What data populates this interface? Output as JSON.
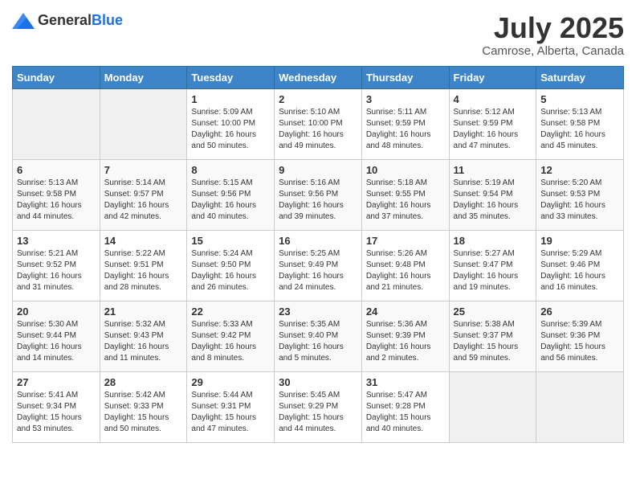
{
  "header": {
    "logo_general": "General",
    "logo_blue": "Blue",
    "month": "July 2025",
    "location": "Camrose, Alberta, Canada"
  },
  "weekdays": [
    "Sunday",
    "Monday",
    "Tuesday",
    "Wednesday",
    "Thursday",
    "Friday",
    "Saturday"
  ],
  "weeks": [
    [
      {
        "day": "",
        "sunrise": "",
        "sunset": "",
        "daylight": ""
      },
      {
        "day": "",
        "sunrise": "",
        "sunset": "",
        "daylight": ""
      },
      {
        "day": "1",
        "sunrise": "Sunrise: 5:09 AM",
        "sunset": "Sunset: 10:00 PM",
        "daylight": "Daylight: 16 hours and 50 minutes."
      },
      {
        "day": "2",
        "sunrise": "Sunrise: 5:10 AM",
        "sunset": "Sunset: 10:00 PM",
        "daylight": "Daylight: 16 hours and 49 minutes."
      },
      {
        "day": "3",
        "sunrise": "Sunrise: 5:11 AM",
        "sunset": "Sunset: 9:59 PM",
        "daylight": "Daylight: 16 hours and 48 minutes."
      },
      {
        "day": "4",
        "sunrise": "Sunrise: 5:12 AM",
        "sunset": "Sunset: 9:59 PM",
        "daylight": "Daylight: 16 hours and 47 minutes."
      },
      {
        "day": "5",
        "sunrise": "Sunrise: 5:13 AM",
        "sunset": "Sunset: 9:58 PM",
        "daylight": "Daylight: 16 hours and 45 minutes."
      }
    ],
    [
      {
        "day": "6",
        "sunrise": "Sunrise: 5:13 AM",
        "sunset": "Sunset: 9:58 PM",
        "daylight": "Daylight: 16 hours and 44 minutes."
      },
      {
        "day": "7",
        "sunrise": "Sunrise: 5:14 AM",
        "sunset": "Sunset: 9:57 PM",
        "daylight": "Daylight: 16 hours and 42 minutes."
      },
      {
        "day": "8",
        "sunrise": "Sunrise: 5:15 AM",
        "sunset": "Sunset: 9:56 PM",
        "daylight": "Daylight: 16 hours and 40 minutes."
      },
      {
        "day": "9",
        "sunrise": "Sunrise: 5:16 AM",
        "sunset": "Sunset: 9:56 PM",
        "daylight": "Daylight: 16 hours and 39 minutes."
      },
      {
        "day": "10",
        "sunrise": "Sunrise: 5:18 AM",
        "sunset": "Sunset: 9:55 PM",
        "daylight": "Daylight: 16 hours and 37 minutes."
      },
      {
        "day": "11",
        "sunrise": "Sunrise: 5:19 AM",
        "sunset": "Sunset: 9:54 PM",
        "daylight": "Daylight: 16 hours and 35 minutes."
      },
      {
        "day": "12",
        "sunrise": "Sunrise: 5:20 AM",
        "sunset": "Sunset: 9:53 PM",
        "daylight": "Daylight: 16 hours and 33 minutes."
      }
    ],
    [
      {
        "day": "13",
        "sunrise": "Sunrise: 5:21 AM",
        "sunset": "Sunset: 9:52 PM",
        "daylight": "Daylight: 16 hours and 31 minutes."
      },
      {
        "day": "14",
        "sunrise": "Sunrise: 5:22 AM",
        "sunset": "Sunset: 9:51 PM",
        "daylight": "Daylight: 16 hours and 28 minutes."
      },
      {
        "day": "15",
        "sunrise": "Sunrise: 5:24 AM",
        "sunset": "Sunset: 9:50 PM",
        "daylight": "Daylight: 16 hours and 26 minutes."
      },
      {
        "day": "16",
        "sunrise": "Sunrise: 5:25 AM",
        "sunset": "Sunset: 9:49 PM",
        "daylight": "Daylight: 16 hours and 24 minutes."
      },
      {
        "day": "17",
        "sunrise": "Sunrise: 5:26 AM",
        "sunset": "Sunset: 9:48 PM",
        "daylight": "Daylight: 16 hours and 21 minutes."
      },
      {
        "day": "18",
        "sunrise": "Sunrise: 5:27 AM",
        "sunset": "Sunset: 9:47 PM",
        "daylight": "Daylight: 16 hours and 19 minutes."
      },
      {
        "day": "19",
        "sunrise": "Sunrise: 5:29 AM",
        "sunset": "Sunset: 9:46 PM",
        "daylight": "Daylight: 16 hours and 16 minutes."
      }
    ],
    [
      {
        "day": "20",
        "sunrise": "Sunrise: 5:30 AM",
        "sunset": "Sunset: 9:44 PM",
        "daylight": "Daylight: 16 hours and 14 minutes."
      },
      {
        "day": "21",
        "sunrise": "Sunrise: 5:32 AM",
        "sunset": "Sunset: 9:43 PM",
        "daylight": "Daylight: 16 hours and 11 minutes."
      },
      {
        "day": "22",
        "sunrise": "Sunrise: 5:33 AM",
        "sunset": "Sunset: 9:42 PM",
        "daylight": "Daylight: 16 hours and 8 minutes."
      },
      {
        "day": "23",
        "sunrise": "Sunrise: 5:35 AM",
        "sunset": "Sunset: 9:40 PM",
        "daylight": "Daylight: 16 hours and 5 minutes."
      },
      {
        "day": "24",
        "sunrise": "Sunrise: 5:36 AM",
        "sunset": "Sunset: 9:39 PM",
        "daylight": "Daylight: 16 hours and 2 minutes."
      },
      {
        "day": "25",
        "sunrise": "Sunrise: 5:38 AM",
        "sunset": "Sunset: 9:37 PM",
        "daylight": "Daylight: 15 hours and 59 minutes."
      },
      {
        "day": "26",
        "sunrise": "Sunrise: 5:39 AM",
        "sunset": "Sunset: 9:36 PM",
        "daylight": "Daylight: 15 hours and 56 minutes."
      }
    ],
    [
      {
        "day": "27",
        "sunrise": "Sunrise: 5:41 AM",
        "sunset": "Sunset: 9:34 PM",
        "daylight": "Daylight: 15 hours and 53 minutes."
      },
      {
        "day": "28",
        "sunrise": "Sunrise: 5:42 AM",
        "sunset": "Sunset: 9:33 PM",
        "daylight": "Daylight: 15 hours and 50 minutes."
      },
      {
        "day": "29",
        "sunrise": "Sunrise: 5:44 AM",
        "sunset": "Sunset: 9:31 PM",
        "daylight": "Daylight: 15 hours and 47 minutes."
      },
      {
        "day": "30",
        "sunrise": "Sunrise: 5:45 AM",
        "sunset": "Sunset: 9:29 PM",
        "daylight": "Daylight: 15 hours and 44 minutes."
      },
      {
        "day": "31",
        "sunrise": "Sunrise: 5:47 AM",
        "sunset": "Sunset: 9:28 PM",
        "daylight": "Daylight: 15 hours and 40 minutes."
      },
      {
        "day": "",
        "sunrise": "",
        "sunset": "",
        "daylight": ""
      },
      {
        "day": "",
        "sunrise": "",
        "sunset": "",
        "daylight": ""
      }
    ]
  ]
}
